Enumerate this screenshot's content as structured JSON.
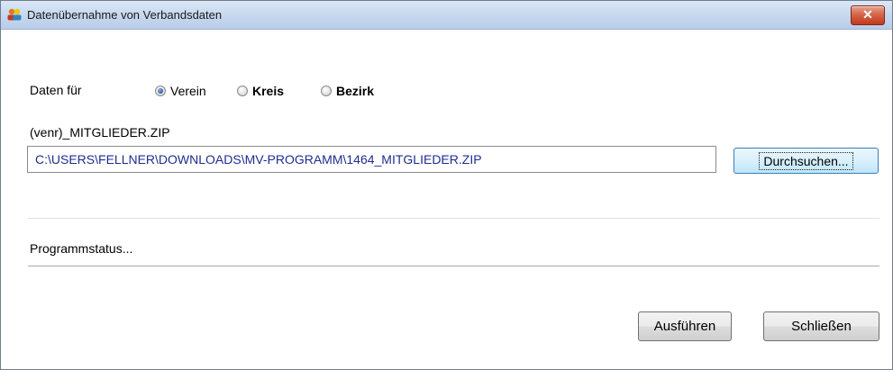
{
  "window": {
    "title": "Datenübernahme von Verbandsdaten",
    "close_label": "✕"
  },
  "data_for": {
    "label": "Daten für",
    "options": [
      {
        "label": "Verein",
        "checked": true
      },
      {
        "label": "Kreis",
        "checked": false
      },
      {
        "label": "Bezirk",
        "checked": false
      }
    ]
  },
  "file": {
    "label": "(venr)_MITGLIEDER.ZIP",
    "path": "C:\\USERS\\FELLNER\\DOWNLOADS\\MV-PROGRAMM\\1464_MITGLIEDER.ZIP",
    "browse_label": "Durchsuchen..."
  },
  "status": {
    "text": "Programmstatus..."
  },
  "buttons": {
    "run_label": "Ausführen",
    "close_label": "Schließen"
  },
  "colors": {
    "path_text": "#1f2d8f",
    "titlebar": "#c7d8ef",
    "close_button": "#c2381c"
  }
}
